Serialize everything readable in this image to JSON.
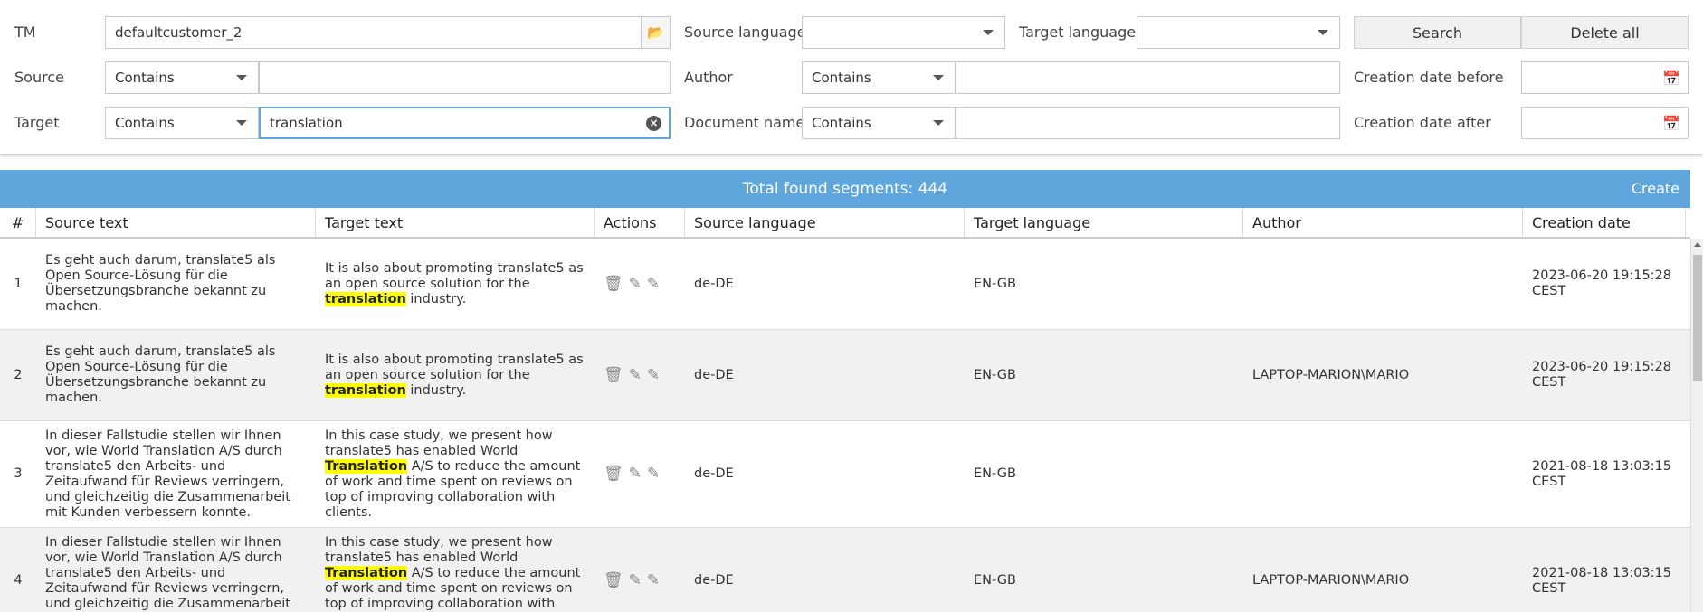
{
  "filters": {
    "tm": {
      "label": "TM",
      "value": "defaultcustomer_2"
    },
    "source": {
      "label": "Source",
      "operator": "Contains",
      "value": ""
    },
    "target": {
      "label": "Target",
      "operator": "Contains",
      "value": "translation"
    },
    "source_language": {
      "label": "Source language",
      "value": ""
    },
    "target_language": {
      "label": "Target language",
      "value": ""
    },
    "author": {
      "label": "Author",
      "operator": "Contains",
      "value": ""
    },
    "document_name": {
      "label": "Document name",
      "operator": "Contains",
      "value": ""
    },
    "creation_before": {
      "label": "Creation date before",
      "value": ""
    },
    "creation_after": {
      "label": "Creation date after",
      "value": ""
    },
    "search_label": "Search",
    "delete_all_label": "Delete all"
  },
  "grid": {
    "title": "Total found segments: 444",
    "create_label": "Create",
    "columns": [
      "#",
      "Source text",
      "Target text",
      "Actions",
      "Source language",
      "Target language",
      "Author",
      "Creation date"
    ],
    "rows": [
      {
        "num": "1",
        "source": "Es geht auch darum, translate5 als Open Source-Lösung für die Übersetzungsbranche bekannt zu machen.",
        "target_pre": "It is also about promoting translate5 as an open source solution for the ",
        "target_hl": "translation",
        "target_post": " industry.",
        "source_lang": "de-DE",
        "target_lang": "EN-GB",
        "author": "",
        "date": "2023-06-20 19:15:28 CEST"
      },
      {
        "num": "2",
        "source": "Es geht auch darum, translate5 als Open Source-Lösung für die Übersetzungsbranche bekannt zu machen.",
        "target_pre": "It is also about promoting translate5 as an open source solution for the ",
        "target_hl": "translation",
        "target_post": " industry.",
        "source_lang": "de-DE",
        "target_lang": "EN-GB",
        "author": "LAPTOP-MARION\\MARIO",
        "date": "2023-06-20 19:15:28 CEST"
      },
      {
        "num": "3",
        "source": "In dieser Fallstudie stellen wir Ihnen vor, wie World Translation A/S durch translate5 den Arbeits- und Zeitaufwand für Reviews verringern, und gleichzeitig die Zusammenarbeit mit Kunden verbessern konnte.",
        "target_pre": "In this case study, we present how translate5 has enabled World ",
        "target_hl": "Translation",
        "target_post": " A/S to reduce the amount of work and time spent on reviews on top of improving collaboration with clients.",
        "source_lang": "de-DE",
        "target_lang": "EN-GB",
        "author": "",
        "date": "2021-08-18 13:03:15 CEST"
      },
      {
        "num": "4",
        "source": "In dieser Fallstudie stellen wir Ihnen vor, wie World Translation A/S durch translate5 den Arbeits- und Zeitaufwand für Reviews verringern, und gleichzeitig die Zusammenarbeit mit Kunden verbessern konnte.",
        "target_pre": "In this case study, we present how translate5 has enabled World ",
        "target_hl": "Translation",
        "target_post": " A/S to reduce the amount of work and time spent on reviews on top of improving collaboration with clients.",
        "source_lang": "de-DE",
        "target_lang": "EN-GB",
        "author": "LAPTOP-MARION\\MARIO",
        "date": "2021-08-18 13:03:15 CEST"
      }
    ]
  },
  "colors": {
    "accent": "#5ea6dc",
    "highlight": "#ffff00"
  }
}
